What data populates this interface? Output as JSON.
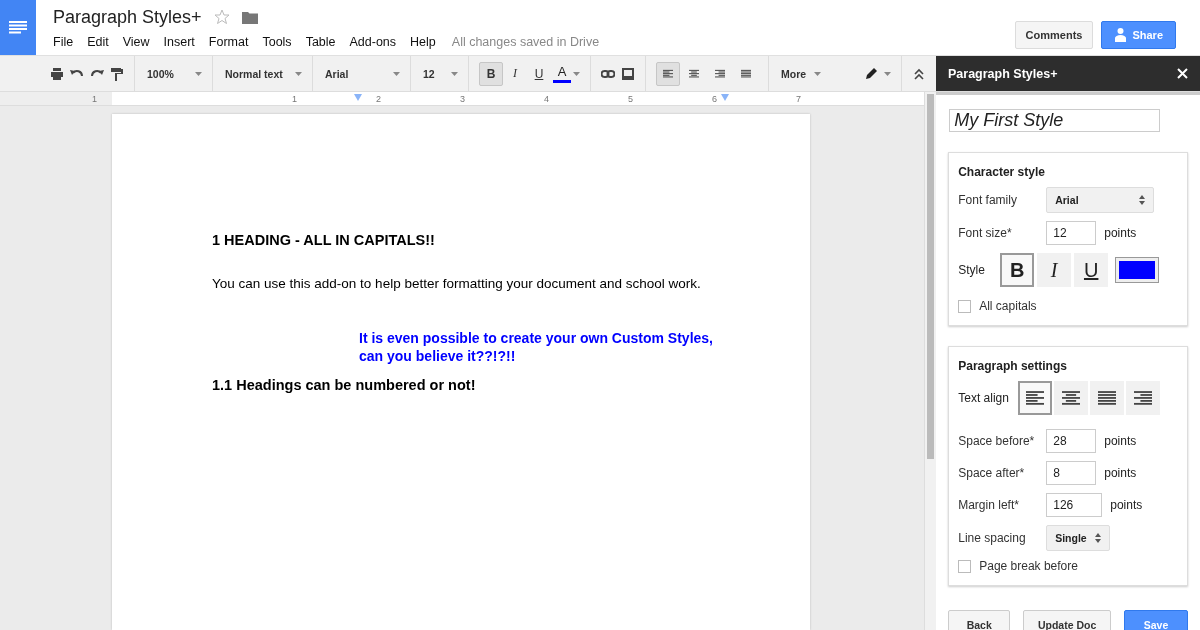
{
  "doc": {
    "title": "Paragraph Styles+",
    "starred": false,
    "menu": [
      "File",
      "Edit",
      "View",
      "Insert",
      "Format",
      "Tools",
      "Table",
      "Add-ons",
      "Help"
    ],
    "save_status": "All changes saved in Drive"
  },
  "header_buttons": [
    {
      "label": "Comments",
      "kind": "plain"
    },
    {
      "label": "Share",
      "kind": "primary"
    }
  ],
  "toolbar": {
    "zoom": "100%",
    "style": "Normal text",
    "font": "Arial",
    "size": "12",
    "format": [
      {
        "kind": "bold",
        "label": "B",
        "selected": true
      },
      {
        "kind": "italic",
        "label": "I",
        "selected": false
      },
      {
        "kind": "underline",
        "label": "U",
        "selected": false
      }
    ],
    "text_color": {
      "label": "A",
      "color": "#0000ff"
    },
    "align": [
      {
        "kind": "left",
        "selected": true
      },
      {
        "kind": "center",
        "selected": false
      },
      {
        "kind": "right",
        "selected": false
      },
      {
        "kind": "justify",
        "selected": false
      }
    ],
    "more": "More"
  },
  "ruler": {
    "left_margin_label": "1",
    "labels": [
      "1",
      "2",
      "3",
      "4",
      "5",
      "6",
      "7"
    ]
  },
  "document": [
    {
      "kind": "heading",
      "text": "1 HEADING - ALL IN CAPITALS!!",
      "color": "#000000"
    },
    {
      "kind": "body",
      "text": "You can use this add-on to help better formatting your document and school work.",
      "color": "#000000"
    },
    {
      "kind": "custom",
      "text": "It is even possible to create your own Custom Styles, can you believe it??!?!!",
      "color": "#0000ff"
    },
    {
      "kind": "heading",
      "text": "1.1 Headings can be numbered or not!",
      "color": "#000000"
    }
  ],
  "sidebar": {
    "title": "Paragraph Styles+",
    "style_name": "My First Style",
    "character_style": {
      "heading": "Character style",
      "font_family": {
        "label": "Font family",
        "value": "Arial"
      },
      "font_size": {
        "label": "Font size*",
        "value": "12",
        "unit": "points"
      },
      "style_label": "Style",
      "styles": [
        {
          "kind": "bold",
          "label": "B",
          "selected": true
        },
        {
          "kind": "italic",
          "label": "I",
          "selected": false
        },
        {
          "kind": "underline",
          "label": "U",
          "selected": false
        }
      ],
      "color": "#0000ff",
      "all_capitals": {
        "label": "All capitals",
        "checked": false
      }
    },
    "paragraph_settings": {
      "heading": "Paragraph settings",
      "text_align_label": "Text align",
      "align": [
        {
          "kind": "left",
          "selected": true
        },
        {
          "kind": "center",
          "selected": false
        },
        {
          "kind": "justify",
          "selected": false
        },
        {
          "kind": "right",
          "selected": false
        }
      ],
      "fields": [
        {
          "label": "Space before*",
          "value": "28",
          "unit": "points"
        },
        {
          "label": "Space after*",
          "value": "8",
          "unit": "points"
        },
        {
          "label": "Margin left*",
          "value": "126",
          "unit": "points"
        }
      ],
      "line_spacing": {
        "label": "Line spacing",
        "value": "Single"
      },
      "page_break_before": {
        "label": "Page break before",
        "checked": false
      }
    },
    "buttons": [
      {
        "label": "Back",
        "kind": "plain"
      },
      {
        "label": "Update Doc",
        "kind": "plain"
      },
      {
        "label": "Save",
        "kind": "primary"
      }
    ]
  }
}
